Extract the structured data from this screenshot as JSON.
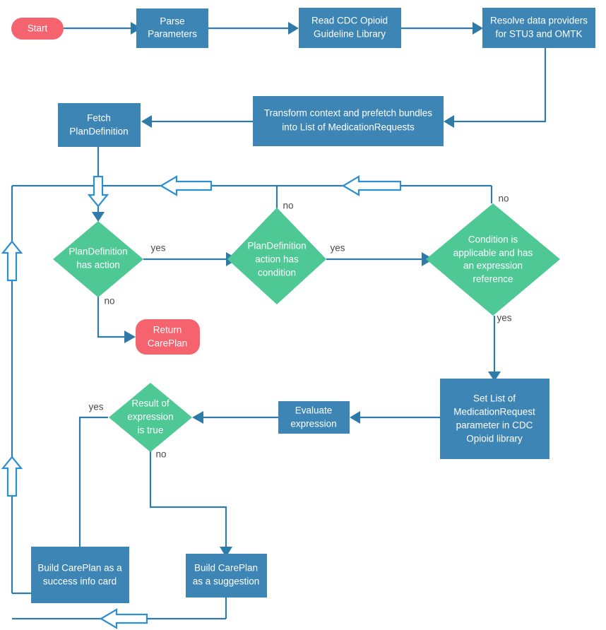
{
  "diagram": {
    "title": "CDC Opioid Guideline CarePlan Flowchart",
    "colors": {
      "process": "#3d85b5",
      "decision": "#4ec894",
      "terminator": "#f4636e",
      "connector": "#2e7aa8",
      "loop_connector": "#2b8fd4",
      "node_text": "#ffffff",
      "edge_text": "#4a4a4a",
      "background": "#ffffff"
    },
    "nodes": [
      {
        "id": "start",
        "type": "terminator",
        "label": "Start"
      },
      {
        "id": "parse",
        "type": "process",
        "label_line1": "Parse",
        "label_line2": "Parameters"
      },
      {
        "id": "read_library",
        "type": "process",
        "label_line1": "Read CDC Opioid",
        "label_line2": "Guideline Library"
      },
      {
        "id": "resolve",
        "type": "process",
        "label_line1": "Resolve data providers",
        "label_line2": "for STU3 and OMTK"
      },
      {
        "id": "transform",
        "type": "process",
        "label_line1": "Transform context and prefetch bundles",
        "label_line2": "into List of MedicationRequests"
      },
      {
        "id": "fetch_plandef",
        "type": "process",
        "label_line1": "Fetch",
        "label_line2": "PlanDefinition"
      },
      {
        "id": "has_action",
        "type": "decision",
        "label_line1": "PlanDefinition",
        "label_line2": "has action"
      },
      {
        "id": "has_condition",
        "type": "decision",
        "label_line1": "PlanDefinition",
        "label_line2": "action has",
        "label_line3": "condition"
      },
      {
        "id": "cond_applicable",
        "type": "decision",
        "label_line1": "Condition is",
        "label_line2": "applicable and has",
        "label_line3": "an expression",
        "label_line4": "reference"
      },
      {
        "id": "return_careplan",
        "type": "terminator",
        "label_line1": "Return",
        "label_line2": "CarePlan"
      },
      {
        "id": "set_list",
        "type": "process",
        "label_line1": "Set List of",
        "label_line2": "MedicationRequest",
        "label_line3": "parameter in CDC",
        "label_line4": "Opioid library"
      },
      {
        "id": "evaluate",
        "type": "process",
        "label_line1": "Evaluate",
        "label_line2": "expression"
      },
      {
        "id": "result_true",
        "type": "decision",
        "label_line1": "Result of",
        "label_line2": "expression",
        "label_line3": "is true"
      },
      {
        "id": "build_success",
        "type": "process",
        "label_line1": "Build CarePlan as a",
        "label_line2": "success info card"
      },
      {
        "id": "build_suggestion",
        "type": "process",
        "label_line1": "Build CarePlan",
        "label_line2": "as a suggestion"
      }
    ],
    "edge_labels": {
      "has_action_yes": "yes",
      "has_action_no": "no",
      "has_condition_yes": "yes",
      "has_condition_no": "no",
      "cond_applicable_yes": "yes",
      "cond_applicable_no": "no",
      "result_true_yes": "yes",
      "result_true_no": "no"
    }
  }
}
